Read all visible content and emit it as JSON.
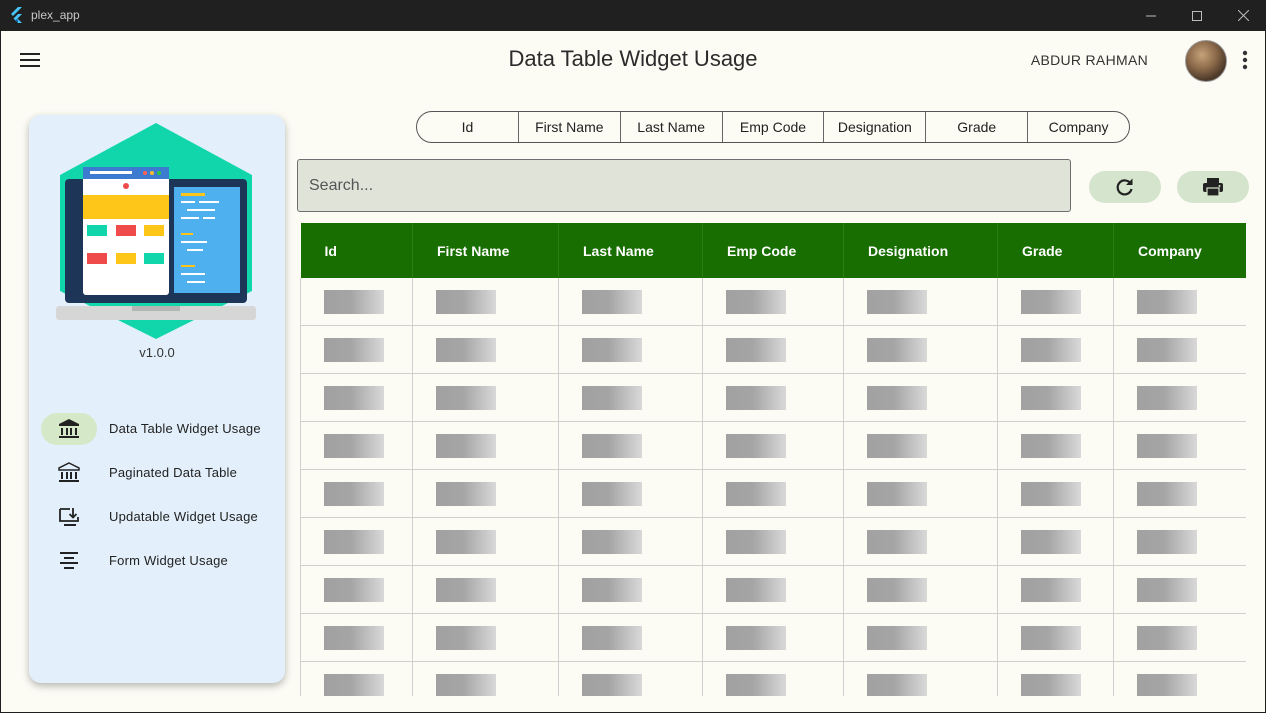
{
  "window": {
    "title": "plex_app"
  },
  "header": {
    "title": "Data Table Widget Usage",
    "user_name": "ABDUR RAHMAN"
  },
  "sidebar": {
    "version": "v1.0.0",
    "items": [
      {
        "label": "Data Table Widget Usage",
        "icon": "bank-icon",
        "active": true
      },
      {
        "label": "Paginated Data Table",
        "icon": "bank-icon",
        "active": false
      },
      {
        "label": "Updatable Widget Usage",
        "icon": "download-monitor-icon",
        "active": false
      },
      {
        "label": "Form Widget Usage",
        "icon": "align-center-icon",
        "active": false
      }
    ]
  },
  "column_chips": [
    "Id",
    "First Name",
    "Last Name",
    "Emp Code",
    "Designation",
    "Grade",
    "Company"
  ],
  "search": {
    "placeholder": "Search..."
  },
  "table": {
    "columns": [
      "Id",
      "First Name",
      "Last Name",
      "Emp Code",
      "Designation",
      "Grade",
      "Company"
    ],
    "loading_rows": 9
  },
  "colors": {
    "header_green": "#186e00",
    "sidebar_bg": "#e3f0fb",
    "active_pill": "#d5e8c7",
    "background": "#fcfbf4"
  }
}
